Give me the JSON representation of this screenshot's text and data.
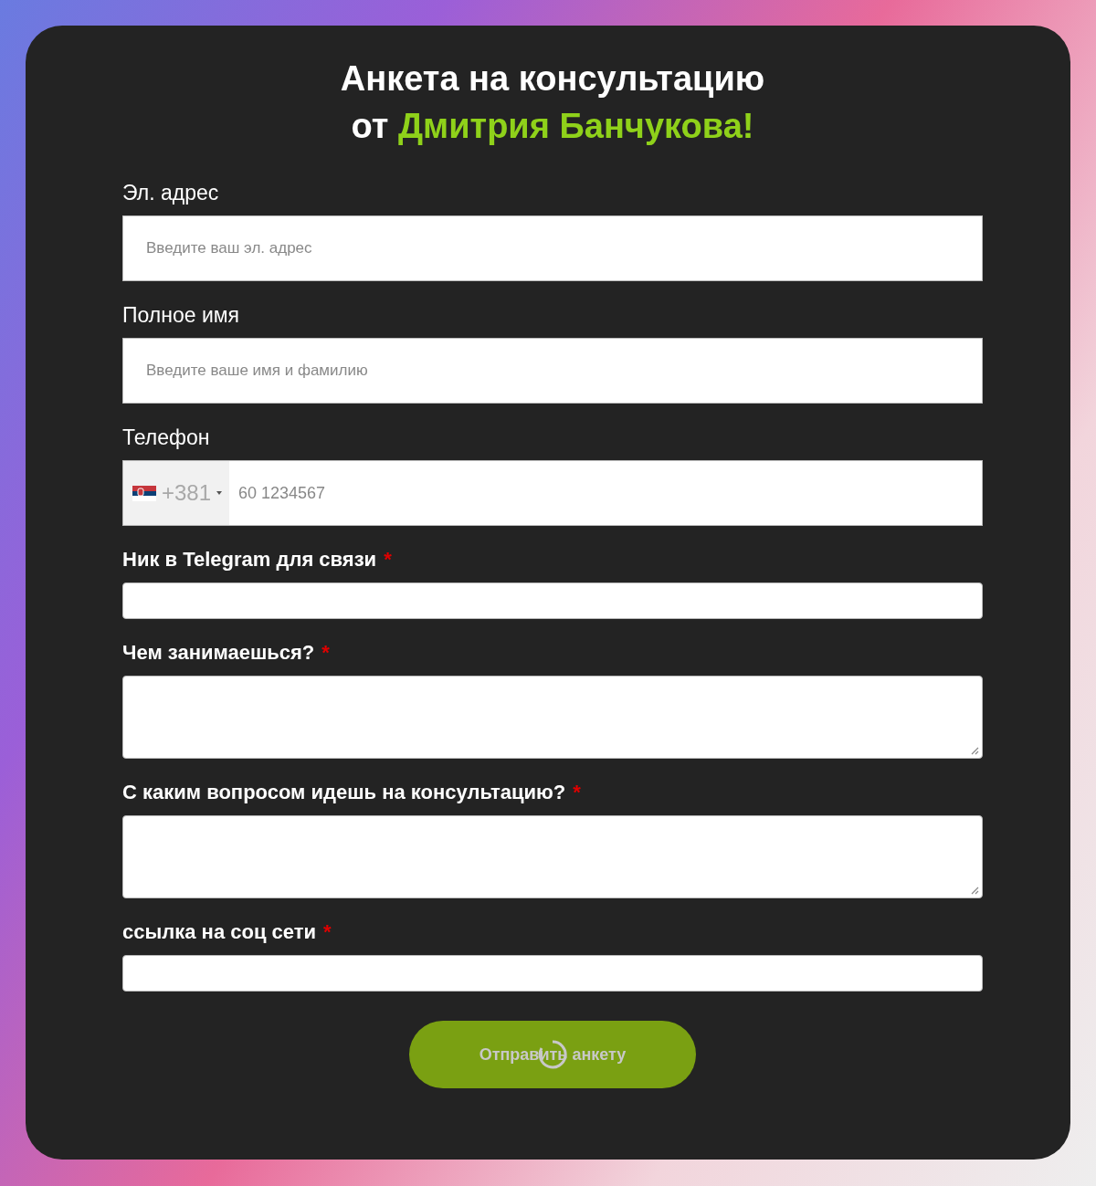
{
  "title": {
    "line_1": "Анкета на консультацию",
    "line_2_prefix": "от",
    "line_2_highlight": "Дмитрия Банчукова!"
  },
  "fields": [
    {
      "kind": "input",
      "label": "Эл. адрес",
      "required": false,
      "placeholder": "Введите ваш эл. адрес"
    },
    {
      "kind": "input",
      "label": "Полное имя",
      "required": false,
      "placeholder": "Введите ваше имя и фамилию"
    },
    {
      "kind": "phone",
      "label": "Телефон",
      "required": false,
      "dial_code": "+381",
      "placeholder": "60 1234567"
    },
    {
      "kind": "line",
      "label": "Ник в Telegram для связи",
      "required": true,
      "required_mark": "*"
    },
    {
      "kind": "textarea",
      "label": "Чем занимаешься?",
      "required": true,
      "required_mark": "*"
    },
    {
      "kind": "textarea",
      "label": "С каким вопросом идешь на консультацию?",
      "required": true,
      "required_mark": "*"
    },
    {
      "kind": "line",
      "label": "ссылка на соц сети",
      "required": true,
      "required_mark": "*"
    }
  ],
  "submit": {
    "label": "Отправить анкету",
    "loading": true
  }
}
